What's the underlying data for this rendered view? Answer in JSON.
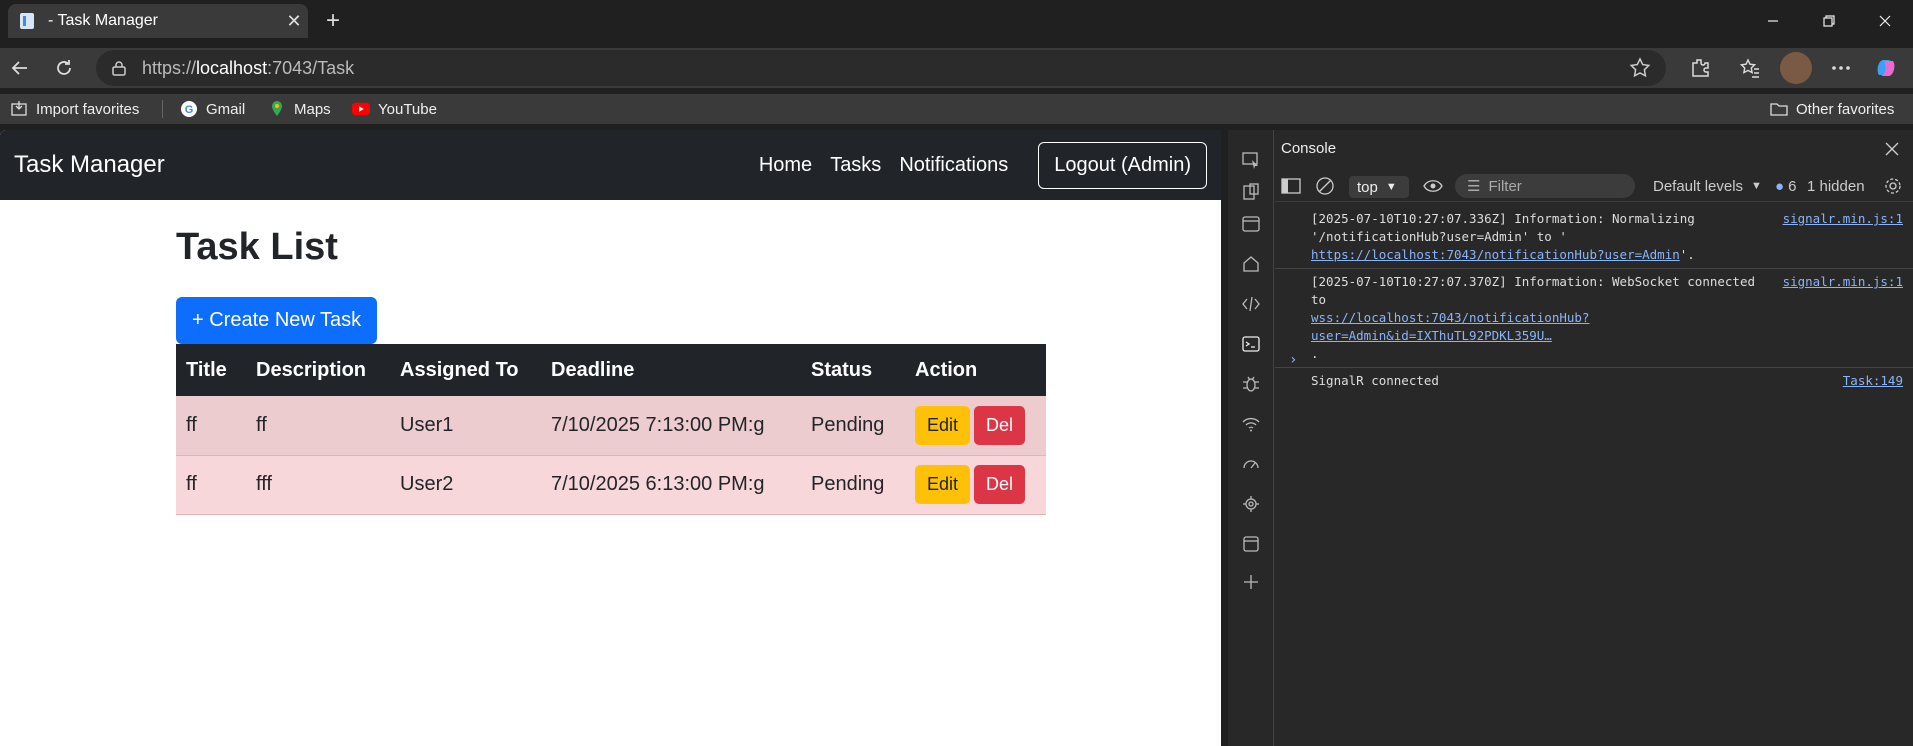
{
  "browser": {
    "tab_title": "- Task Manager",
    "url_scheme": "https://",
    "url_host": "localhost",
    "url_rest": ":7043/Task",
    "bookmarks": [
      "Import favorites",
      "Gmail",
      "Maps",
      "YouTube"
    ],
    "other_favorites": "Other favorites"
  },
  "site": {
    "brand": "Task Manager",
    "nav": [
      "Home",
      "Tasks",
      "Notifications"
    ],
    "logout": "Logout (Admin)",
    "page_title": "Task List",
    "create_button": "+ Create New Task",
    "columns": [
      "Title",
      "Description",
      "Assigned To",
      "Deadline",
      "Status",
      "Action"
    ],
    "rows": [
      {
        "title": "ff",
        "description": "ff",
        "assigned": "User1",
        "deadline": "7/10/2025 7:13:00 PM:g",
        "status": "Pending"
      },
      {
        "title": "ff",
        "description": "fff",
        "assigned": "User2",
        "deadline": "7/10/2025 6:13:00 PM:g",
        "status": "Pending"
      }
    ],
    "edit_label": "Edit",
    "del_label": "Del"
  },
  "devtools": {
    "panel_title": "Console",
    "context": "top",
    "filter_placeholder": "Filter",
    "levels": "Default levels",
    "issues_count": "6",
    "hidden": "1 hidden",
    "logs": [
      {
        "text": "[2025-07-10T10:27:07.336Z] Information: Normalizing '/notificationHub?user=Admin' to '",
        "link": "https://localhost:7043/notificationHub?user=Admin",
        "tail": "'.",
        "source": "signalr.min.js:1"
      },
      {
        "text": "[2025-07-10T10:27:07.370Z] Information: WebSocket connected to",
        "link": "wss://localhost:7043/notificationHub?user=Admin&id=IXThuTL92PDKL359U…",
        "tail": ".",
        "source": "signalr.min.js:1"
      },
      {
        "text": "SignalR connected",
        "link": "",
        "tail": "",
        "source": "Task:149"
      }
    ]
  },
  "colors": {
    "primary": "#0d6efd",
    "warning": "#ffc107",
    "danger": "#dc3545",
    "dark": "#212529",
    "row_danger": "#f8d7da"
  }
}
